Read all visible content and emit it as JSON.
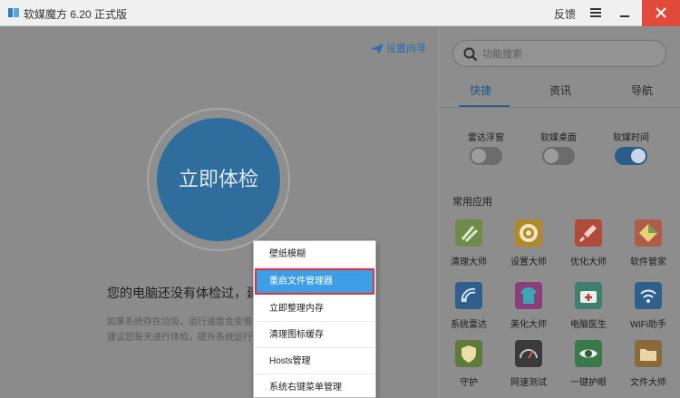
{
  "titlebar": {
    "title": "软媒魔方 6.20 正式版",
    "feedback": "反馈"
  },
  "main": {
    "setup_guide": "设置向导",
    "check_button": "立即体检",
    "notice": "您的电脑还没有体检过，建",
    "hint_line1": "如果系统存在垃圾，运行速度会变慢",
    "hint_line2": "建议您每天进行体检，提升系统运行"
  },
  "side": {
    "search_placeholder": "功能搜索",
    "tabs": [
      "快捷",
      "资讯",
      "导航"
    ],
    "toggles": [
      {
        "label": "雷达浮窗",
        "on": false
      },
      {
        "label": "软媒桌面",
        "on": false
      },
      {
        "label": "软媒时间",
        "on": true
      }
    ],
    "section_title": "常用应用",
    "apps": [
      {
        "label": "清理大师",
        "icon": "broom-icon",
        "color": "#6f8a4a"
      },
      {
        "label": "设置大师",
        "icon": "gear-icon",
        "color": "#b08a2a"
      },
      {
        "label": "优化大师",
        "icon": "rocket-icon",
        "color": "#b04a3a"
      },
      {
        "label": "软件管家",
        "icon": "diamond-icon",
        "color": "#b05c4a"
      },
      {
        "label": "系统雷达",
        "icon": "radar-icon",
        "color": "#2f5f8a"
      },
      {
        "label": "美化大师",
        "icon": "tshirt-icon",
        "color": "#8a3f7a"
      },
      {
        "label": "电脑医生",
        "icon": "medkit-icon",
        "color": "#3f7f6f"
      },
      {
        "label": "WiFi助手",
        "icon": "wifi-icon",
        "color": "#2f5f8a"
      },
      {
        "label": "守护",
        "icon": "shield-icon",
        "color": "#5f7a3a"
      },
      {
        "label": "网速测试",
        "icon": "speedometer-icon",
        "color": "#3a3a3a"
      },
      {
        "label": "一键护眼",
        "icon": "eye-icon",
        "color": "#3a7a4a"
      },
      {
        "label": "文件大师",
        "icon": "folder-icon",
        "color": "#8a6a3a"
      }
    ]
  },
  "context_menu": {
    "items": [
      "壁纸模糊",
      "重启文件管理器",
      "立即整理内存",
      "清理图标缓存",
      "Hosts管理",
      "系统右键菜单管理"
    ],
    "selected_index": 1
  }
}
